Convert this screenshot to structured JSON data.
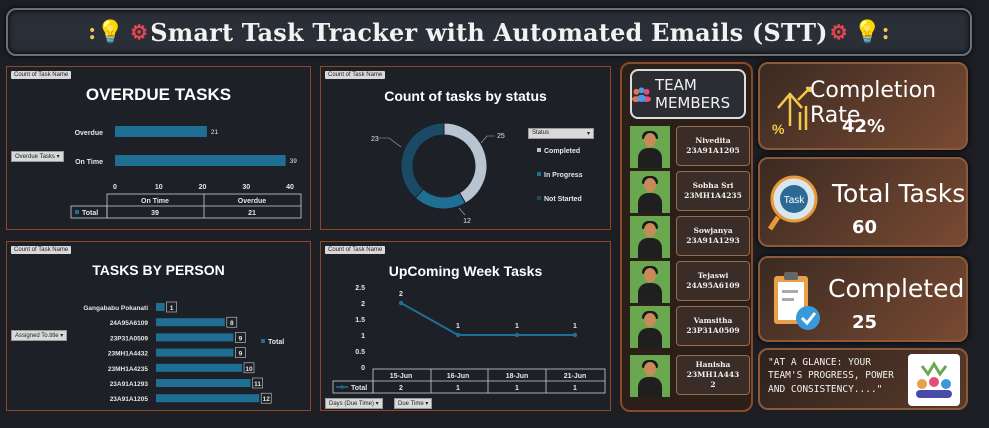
{
  "header": {
    "title": "Smart Task Tracker with Automated Emails (STT)"
  },
  "overdue": {
    "tag": "Count of Task Name",
    "title": "OVERDUE TASKS",
    "filter": "Overdue Tasks ▾",
    "total_label": "Total"
  },
  "status_panel": {
    "tag": "Count of Task Name",
    "title": "Count of tasks by status",
    "filter": "Status",
    "label_23": "23",
    "label_25": "25",
    "label_12": "12"
  },
  "person_panel": {
    "tag": "Count of Task Name",
    "title": "TASKS BY PERSON",
    "filter": "Assigned To.title ▾",
    "legend": "Total"
  },
  "week_panel": {
    "tag": "Count of Task Name",
    "title": "UpComing Week Tasks",
    "filter1": "Days (Due Time) ▾",
    "filter2": "Due Time ▾",
    "total_label": "Total"
  },
  "chart_data": [
    {
      "type": "bar",
      "title": "OVERDUE TASKS",
      "categories": [
        "Overdue",
        "On Time"
      ],
      "values": [
        21,
        39
      ],
      "xlim": [
        0,
        40
      ],
      "xticks": [
        "0",
        "10",
        "20",
        "30",
        "40"
      ],
      "table_headers": [
        "On Time",
        "Overdue"
      ],
      "table_values": [
        "39",
        "21"
      ]
    },
    {
      "type": "pie",
      "title": "Count of tasks by status",
      "categories": [
        "Completed",
        "In Progress",
        "Not Started"
      ],
      "values": [
        25,
        12,
        23
      ],
      "colors": [
        "#b8c4d0",
        "#1f6f94",
        "#1a4a66"
      ]
    },
    {
      "type": "bar",
      "title": "TASKS BY PERSON",
      "categories": [
        "Gangababu Pokanati",
        "24A95A6109",
        "23P31A0509",
        "23MH1A4432",
        "23MH1A4235",
        "23A91A1293",
        "23A91A1205"
      ],
      "values": [
        1,
        8,
        9,
        9,
        10,
        11,
        12
      ],
      "series": [
        {
          "name": "Total",
          "values": [
            1,
            8,
            9,
            9,
            10,
            11,
            12
          ]
        }
      ]
    },
    {
      "type": "line",
      "title": "UpComing Week Tasks",
      "categories": [
        "15-Jun",
        "16-Jun",
        "18-Jun",
        "21-Jun"
      ],
      "values": [
        2,
        1,
        1,
        1
      ],
      "ylim": [
        0,
        2.5
      ],
      "yticks": [
        "0",
        "0.5",
        "1",
        "1.5",
        "2",
        "2.5"
      ],
      "series": [
        {
          "name": "Total",
          "values": [
            2,
            1,
            1,
            1
          ]
        }
      ]
    }
  ],
  "team": {
    "header": "TEAM MEMBERS",
    "members": [
      {
        "name": "Nivedita",
        "id": "23A91A1205"
      },
      {
        "name": "Sobha Sri",
        "id": "23MH1A4235"
      },
      {
        "name": "Sowjanya",
        "id": "23A91A1293"
      },
      {
        "name": "Tejaswi",
        "id": "24A95A6109"
      },
      {
        "name": "Vamsitha",
        "id": "23P31A0509"
      },
      {
        "name": "Hanisha",
        "id": "23MH1A443",
        "id2": "2"
      }
    ]
  },
  "kpis": {
    "completion_label": "Completion Rate",
    "completion_value": "42%",
    "total_label": "Total Tasks",
    "total_value": "60",
    "completed_label": "Completed",
    "completed_value": "25",
    "task_icon_text": "Task"
  },
  "glance": {
    "text": "\"AT A GLANCE: YOUR TEAM'S PROGRESS, POWER AND CONSISTENCY....\""
  }
}
